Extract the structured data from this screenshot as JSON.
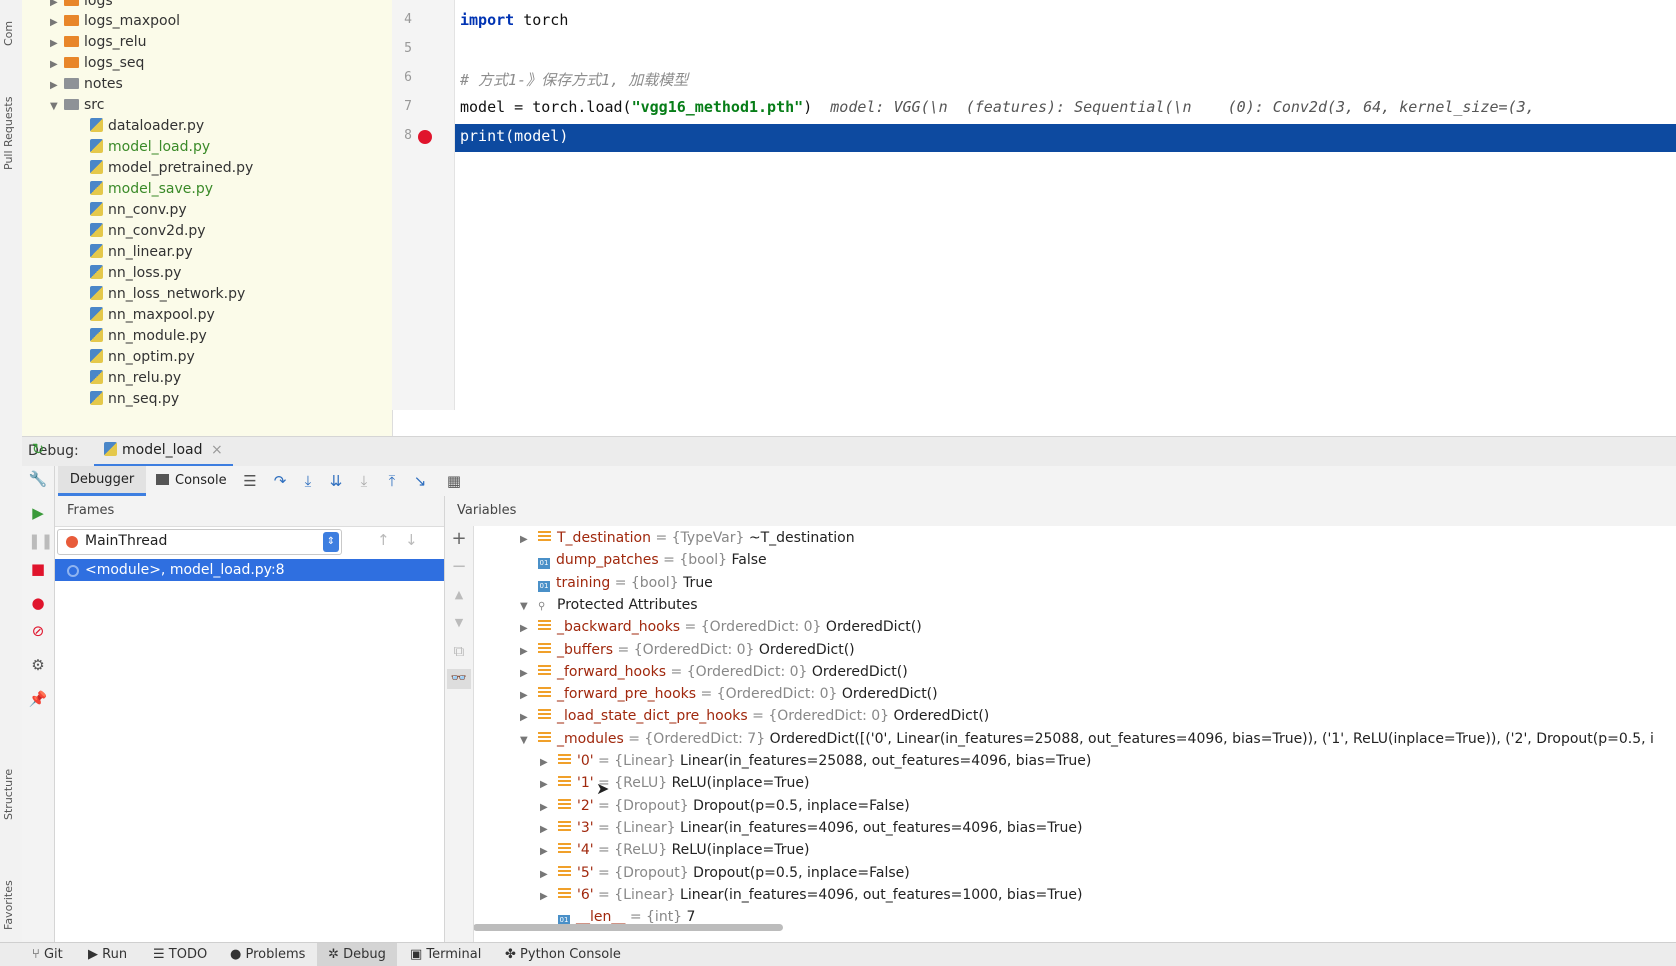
{
  "left_strip": {
    "labels": [
      "Com",
      "Pull Requests",
      "Structure",
      "Favorites"
    ]
  },
  "project_tree": {
    "items": [
      {
        "label": "logs",
        "kind": "folder",
        "expanded": false
      },
      {
        "label": "logs_maxpool",
        "kind": "folder",
        "expanded": false
      },
      {
        "label": "logs_relu",
        "kind": "folder",
        "expanded": false
      },
      {
        "label": "logs_seq",
        "kind": "folder",
        "expanded": false
      },
      {
        "label": "notes",
        "kind": "folder-grey",
        "expanded": false
      },
      {
        "label": "src",
        "kind": "folder-grey",
        "expanded": true
      },
      {
        "label": "dataloader.py",
        "kind": "py"
      },
      {
        "label": "model_load.py",
        "kind": "py",
        "modified": true
      },
      {
        "label": "model_pretrained.py",
        "kind": "py"
      },
      {
        "label": "model_save.py",
        "kind": "py",
        "modified": true
      },
      {
        "label": "nn_conv.py",
        "kind": "py"
      },
      {
        "label": "nn_conv2d.py",
        "kind": "py"
      },
      {
        "label": "nn_linear.py",
        "kind": "py"
      },
      {
        "label": "nn_loss.py",
        "kind": "py"
      },
      {
        "label": "nn_loss_network.py",
        "kind": "py"
      },
      {
        "label": "nn_maxpool.py",
        "kind": "py"
      },
      {
        "label": "nn_module.py",
        "kind": "py"
      },
      {
        "label": "nn_optim.py",
        "kind": "py"
      },
      {
        "label": "nn_relu.py",
        "kind": "py"
      },
      {
        "label": "nn_seq.py",
        "kind": "py"
      }
    ]
  },
  "editor": {
    "line_numbers": [
      "4",
      "5",
      "6",
      "7",
      "8"
    ],
    "line4_kw": "import",
    "line4_rest": " torch",
    "line6_comment": "# 方式1-》保存方式1, 加载模型",
    "line7_code": "model = torch.load(",
    "line7_str": "\"vgg16_method1.pth\"",
    "line7_end": ")",
    "line7_hint": "model: VGG(\\n  (features): Sequential(\\n    (0): Conv2d(3, 64, kernel_size=(3,",
    "line8_code": "print(model)"
  },
  "debug": {
    "label": "Debug:",
    "tab": "model_load",
    "toolbar": {
      "debugger": "Debugger",
      "console": "Console"
    },
    "frames": {
      "title": "Frames",
      "thread": "MainThread",
      "frame": "<module>, model_load.py:8"
    },
    "variables": {
      "title": "Variables",
      "rows": [
        {
          "indent": 1,
          "arrow": "▶",
          "icon": "field",
          "name": "T_destination",
          "type": " = {TypeVar} ",
          "value": "~T_destination"
        },
        {
          "indent": 1,
          "arrow": "",
          "icon": "bool",
          "name": "dump_patches",
          "type": " = {bool} ",
          "value": "False"
        },
        {
          "indent": 1,
          "arrow": "",
          "icon": "bool",
          "name": "training",
          "type": " = {bool} ",
          "value": "True"
        },
        {
          "indent": 1,
          "arrow": "▼",
          "icon": "prot",
          "name": "Protected Attributes",
          "type": "",
          "value": "",
          "plain": true
        },
        {
          "indent": 2,
          "arrow": "▶",
          "icon": "field",
          "name": "_backward_hooks",
          "type": " = {OrderedDict: 0} ",
          "value": "OrderedDict()"
        },
        {
          "indent": 2,
          "arrow": "▶",
          "icon": "field",
          "name": "_buffers",
          "type": " = {OrderedDict: 0} ",
          "value": "OrderedDict()"
        },
        {
          "indent": 2,
          "arrow": "▶",
          "icon": "field",
          "name": "_forward_hooks",
          "type": " = {OrderedDict: 0} ",
          "value": "OrderedDict()"
        },
        {
          "indent": 2,
          "arrow": "▶",
          "icon": "field",
          "name": "_forward_pre_hooks",
          "type": " = {OrderedDict: 0} ",
          "value": "OrderedDict()"
        },
        {
          "indent": 2,
          "arrow": "▶",
          "icon": "field",
          "name": "_load_state_dict_pre_hooks",
          "type": " = {OrderedDict: 0} ",
          "value": "OrderedDict()"
        },
        {
          "indent": 2,
          "arrow": "▼",
          "icon": "field",
          "name": "_modules",
          "type": " = {OrderedDict: 7} ",
          "value": "OrderedDict([('0', Linear(in_features=25088, out_features=4096, bias=True)), ('1', ReLU(inplace=True)), ('2', Dropout(p=0.5, i"
        },
        {
          "indent": 3,
          "arrow": "▶",
          "icon": "field",
          "name": "'0'",
          "type": " = {Linear} ",
          "value": "Linear(in_features=25088, out_features=4096, bias=True)"
        },
        {
          "indent": 3,
          "arrow": "▶",
          "icon": "field",
          "name": "'1'",
          "type": " = {ReLU} ",
          "value": "ReLU(inplace=True)"
        },
        {
          "indent": 3,
          "arrow": "▶",
          "icon": "field",
          "name": "'2'",
          "type": " = {Dropout} ",
          "value": "Dropout(p=0.5, inplace=False)"
        },
        {
          "indent": 3,
          "arrow": "▶",
          "icon": "field",
          "name": "'3'",
          "type": " = {Linear} ",
          "value": "Linear(in_features=4096, out_features=4096, bias=True)"
        },
        {
          "indent": 3,
          "arrow": "▶",
          "icon": "field",
          "name": "'4'",
          "type": " = {ReLU} ",
          "value": "ReLU(inplace=True)"
        },
        {
          "indent": 3,
          "arrow": "▶",
          "icon": "field",
          "name": "'5'",
          "type": " = {Dropout} ",
          "value": "Dropout(p=0.5, inplace=False)"
        },
        {
          "indent": 3,
          "arrow": "▶",
          "icon": "field",
          "name": "'6'",
          "type": " = {Linear} ",
          "value": "Linear(in_features=4096, out_features=1000, bias=True)"
        },
        {
          "indent": 3,
          "arrow": "",
          "icon": "int",
          "name": "__len__",
          "type": " = {int} ",
          "value": "7"
        }
      ]
    }
  },
  "statusbar": {
    "items": [
      "Git",
      "Run",
      "TODO",
      "Problems",
      "Debug",
      "Terminal",
      "Python Console"
    ],
    "active": "Debug"
  },
  "colors": {
    "selection": "#0d4aa0",
    "frame_selected": "#2f6fe0",
    "breakpoint": "#e0142c",
    "tree_bg": "#fbfbe9"
  }
}
